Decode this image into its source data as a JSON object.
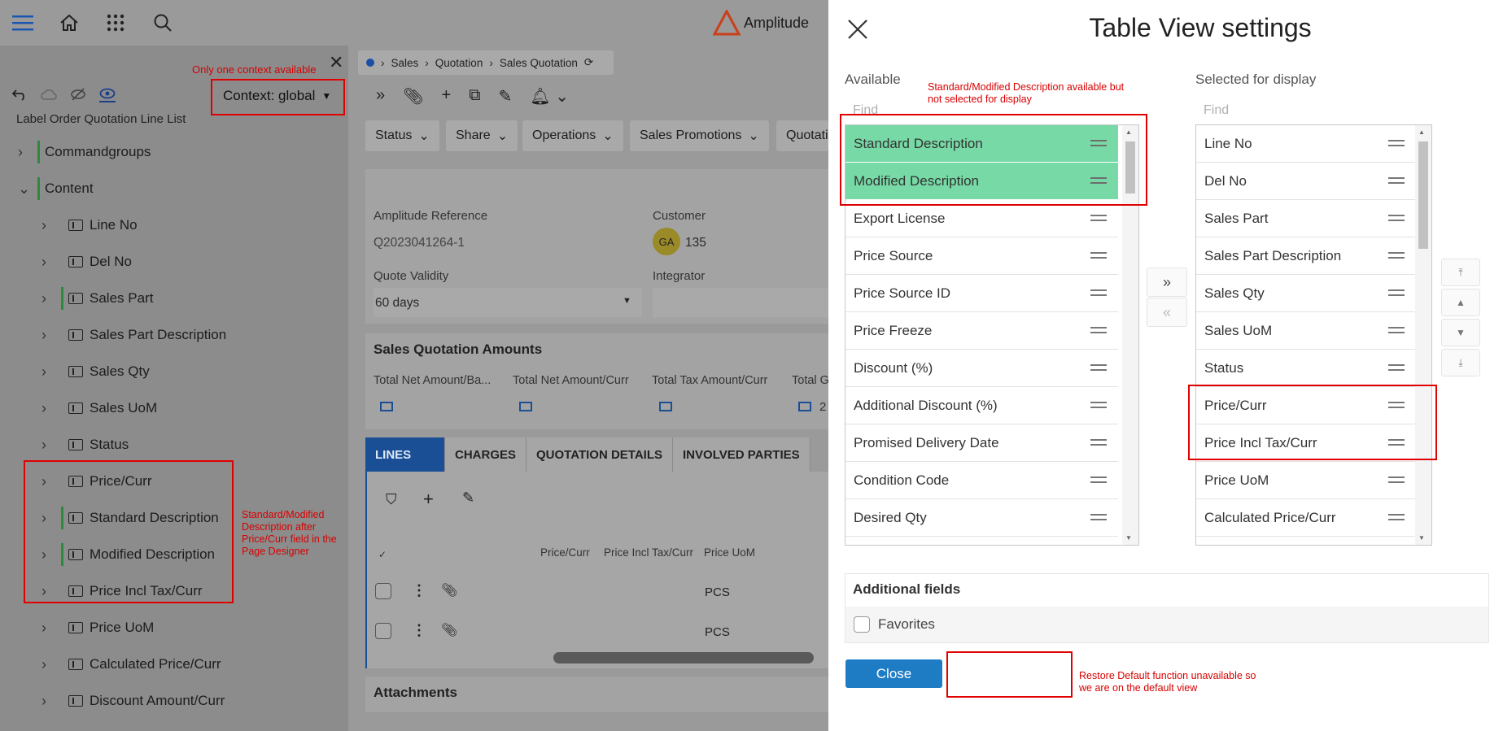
{
  "app": {
    "brand": "Amplitude",
    "context_note": "Only one context available",
    "context_button": "Context: global",
    "left_label": "Label    Order Quotation Line List",
    "tree": [
      {
        "label": "Commandgroups",
        "level": 0,
        "green": true,
        "field": false
      },
      {
        "label": "Content",
        "level": 0,
        "green": true,
        "field": false,
        "expanded": true
      },
      {
        "label": "Line No",
        "level": 1,
        "green": false,
        "field": true
      },
      {
        "label": "Del No",
        "level": 1,
        "green": false,
        "field": true
      },
      {
        "label": "Sales Part",
        "level": 1,
        "green": true,
        "field": true
      },
      {
        "label": "Sales Part Description",
        "level": 1,
        "green": false,
        "field": true
      },
      {
        "label": "Sales Qty",
        "level": 1,
        "green": false,
        "field": true
      },
      {
        "label": "Sales UoM",
        "level": 1,
        "green": false,
        "field": true
      },
      {
        "label": "Status",
        "level": 1,
        "green": false,
        "field": true
      },
      {
        "label": "Price/Curr",
        "level": 1,
        "green": false,
        "field": true
      },
      {
        "label": "Standard Description",
        "level": 1,
        "green": true,
        "field": true
      },
      {
        "label": "Modified Description",
        "level": 1,
        "green": true,
        "field": true
      },
      {
        "label": "Price Incl Tax/Curr",
        "level": 1,
        "green": false,
        "field": true
      },
      {
        "label": "Price UoM",
        "level": 1,
        "green": false,
        "field": true
      },
      {
        "label": "Calculated Price/Curr",
        "level": 1,
        "green": false,
        "field": true
      },
      {
        "label": "Discount Amount/Curr",
        "level": 1,
        "green": false,
        "field": true
      }
    ],
    "tree_note": "Standard/Modified Description after Price/Curr field in the Page Designer",
    "breadcrumb": [
      "Sales",
      "Quotation",
      "Sales Quotation"
    ],
    "chips": [
      "Status",
      "Share",
      "Operations",
      "Sales Promotions",
      "Quotatio"
    ],
    "fields": {
      "ref_label": "Amplitude Reference",
      "ref_value": "Q2023041264-1",
      "customer_label": "Customer",
      "customer_initials": "GA",
      "customer_value": "135",
      "validity_label": "Quote Validity",
      "validity_value": "60 days",
      "integrator_label": "Integrator"
    },
    "amounts": {
      "title": "Sales Quotation Amounts",
      "cols": [
        "Total Net Amount/Ba...",
        "Total Net Amount/Curr",
        "Total Tax Amount/Curr",
        "Total G"
      ],
      "partial_value": "2"
    },
    "tabs": [
      "LINES",
      "CHARGES",
      "QUOTATION DETAILS",
      "INVOLVED PARTIES"
    ],
    "grid_headers": [
      "Price/Curr",
      "Price Incl Tax/Curr",
      "Price UoM"
    ],
    "grid_rows": [
      "PCS",
      "PCS"
    ],
    "attachments": "Attachments"
  },
  "dialog": {
    "title": "Table View settings",
    "available_label": "Available",
    "selected_label": "Selected for display",
    "find_placeholder": "Find",
    "available": [
      {
        "label": "Standard Description",
        "highlight": true
      },
      {
        "label": "Modified Description",
        "highlight": true
      },
      {
        "label": "Export License",
        "highlight": false
      },
      {
        "label": "Price Source",
        "highlight": false
      },
      {
        "label": "Price Source ID",
        "highlight": false
      },
      {
        "label": "Price Freeze",
        "highlight": false
      },
      {
        "label": "Discount (%)",
        "highlight": false
      },
      {
        "label": "Additional Discount (%)",
        "highlight": false
      },
      {
        "label": "Promised Delivery Date",
        "highlight": false
      },
      {
        "label": "Condition Code",
        "highlight": false
      },
      {
        "label": "Desired Qty",
        "highlight": false
      }
    ],
    "selected": [
      "Line No",
      "Del No",
      "Sales Part",
      "Sales Part Description",
      "Sales Qty",
      "Sales UoM",
      "Status",
      "Price/Curr",
      "Price Incl Tax/Curr",
      "Price UoM",
      "Calculated Price/Curr"
    ],
    "additional_fields_title": "Additional fields",
    "favorites_label": "Favorites",
    "close_label": "Close",
    "note_available": "Standard/Modified Description available but not selected for display",
    "note_restore": "Restore Default function unavailable so we are on the default view"
  }
}
